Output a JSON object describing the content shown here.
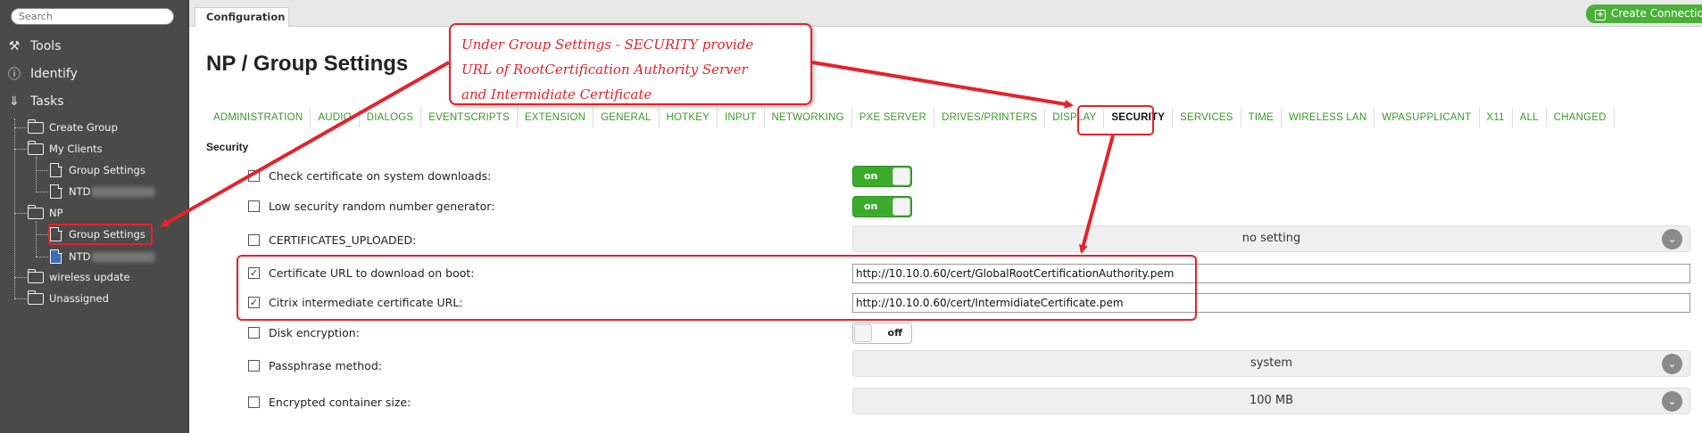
{
  "search": {
    "placeholder": "Search"
  },
  "sidebar": {
    "menu": [
      {
        "label": "Tools",
        "icon": "tools-icon"
      },
      {
        "label": "Identify",
        "icon": "info-icon"
      },
      {
        "label": "Tasks",
        "icon": "chevron-double-down-icon"
      }
    ],
    "tree": {
      "create_group": "Create Group",
      "my_clients": "My Clients",
      "group_settings_1": "Group Settings",
      "ntd_1": "NTD",
      "np": "NP",
      "group_settings_2": "Group Settings",
      "ntd_2": "NTD",
      "wireless_update": "wireless update",
      "unassigned": "Unassigned"
    }
  },
  "topbar": {
    "tab": "Configuration",
    "create_connection": "Create Connection"
  },
  "main": {
    "title": "NP / Group Settings",
    "tabs": [
      "ADMINISTRATION",
      "AUDIO",
      "DIALOGS",
      "EVENTSCRIPTS",
      "EXTENSION",
      "GENERAL",
      "HOTKEY",
      "INPUT",
      "NETWORKING",
      "PXE SERVER",
      "DRIVES/PRINTERS",
      "DISPLAY",
      "SECURITY",
      "SERVICES",
      "TIME",
      "WIRELESS LAN",
      "WPASUPPLICANT",
      "X11",
      "ALL",
      "CHANGED"
    ],
    "active_tab": "SECURITY",
    "section": "Security",
    "rows": {
      "check_cert": {
        "label": "Check certificate on system downloads:",
        "checked": false,
        "value": "on"
      },
      "low_sec": {
        "label": "Low security random number generator:",
        "checked": false,
        "value": "on"
      },
      "certs_uploaded": {
        "label": "CERTIFICATES_UPLOADED:",
        "checked": false,
        "value": "no setting"
      },
      "cert_url": {
        "label": "Certificate URL to download on boot:",
        "checked": true,
        "value": "http://10.10.0.60/cert/GlobalRootCertificationAuthority.pem"
      },
      "citrix_url": {
        "label": "Citrix intermediate certificate URL:",
        "checked": true,
        "value": "http://10.10.0.60/cert/IntermidiateCertificate.pem"
      },
      "disk_enc": {
        "label": "Disk encryption:",
        "checked": false,
        "value": "off"
      },
      "passphrase": {
        "label": "Passphrase method:",
        "checked": false,
        "value": "system"
      },
      "container_size": {
        "label": "Encrypted container size:",
        "checked": false,
        "value": "100 MB"
      }
    }
  },
  "annotation": {
    "line1": "Under Group Settings - SECURITY provide",
    "line2": "URL of RootCertification Authority Server",
    "line3": "and Intermidiate Certificate"
  },
  "colors": {
    "accent_green": "#3a9a2a",
    "annotation_red": "#e4232b",
    "sidebar_bg": "#4a4a4a"
  }
}
